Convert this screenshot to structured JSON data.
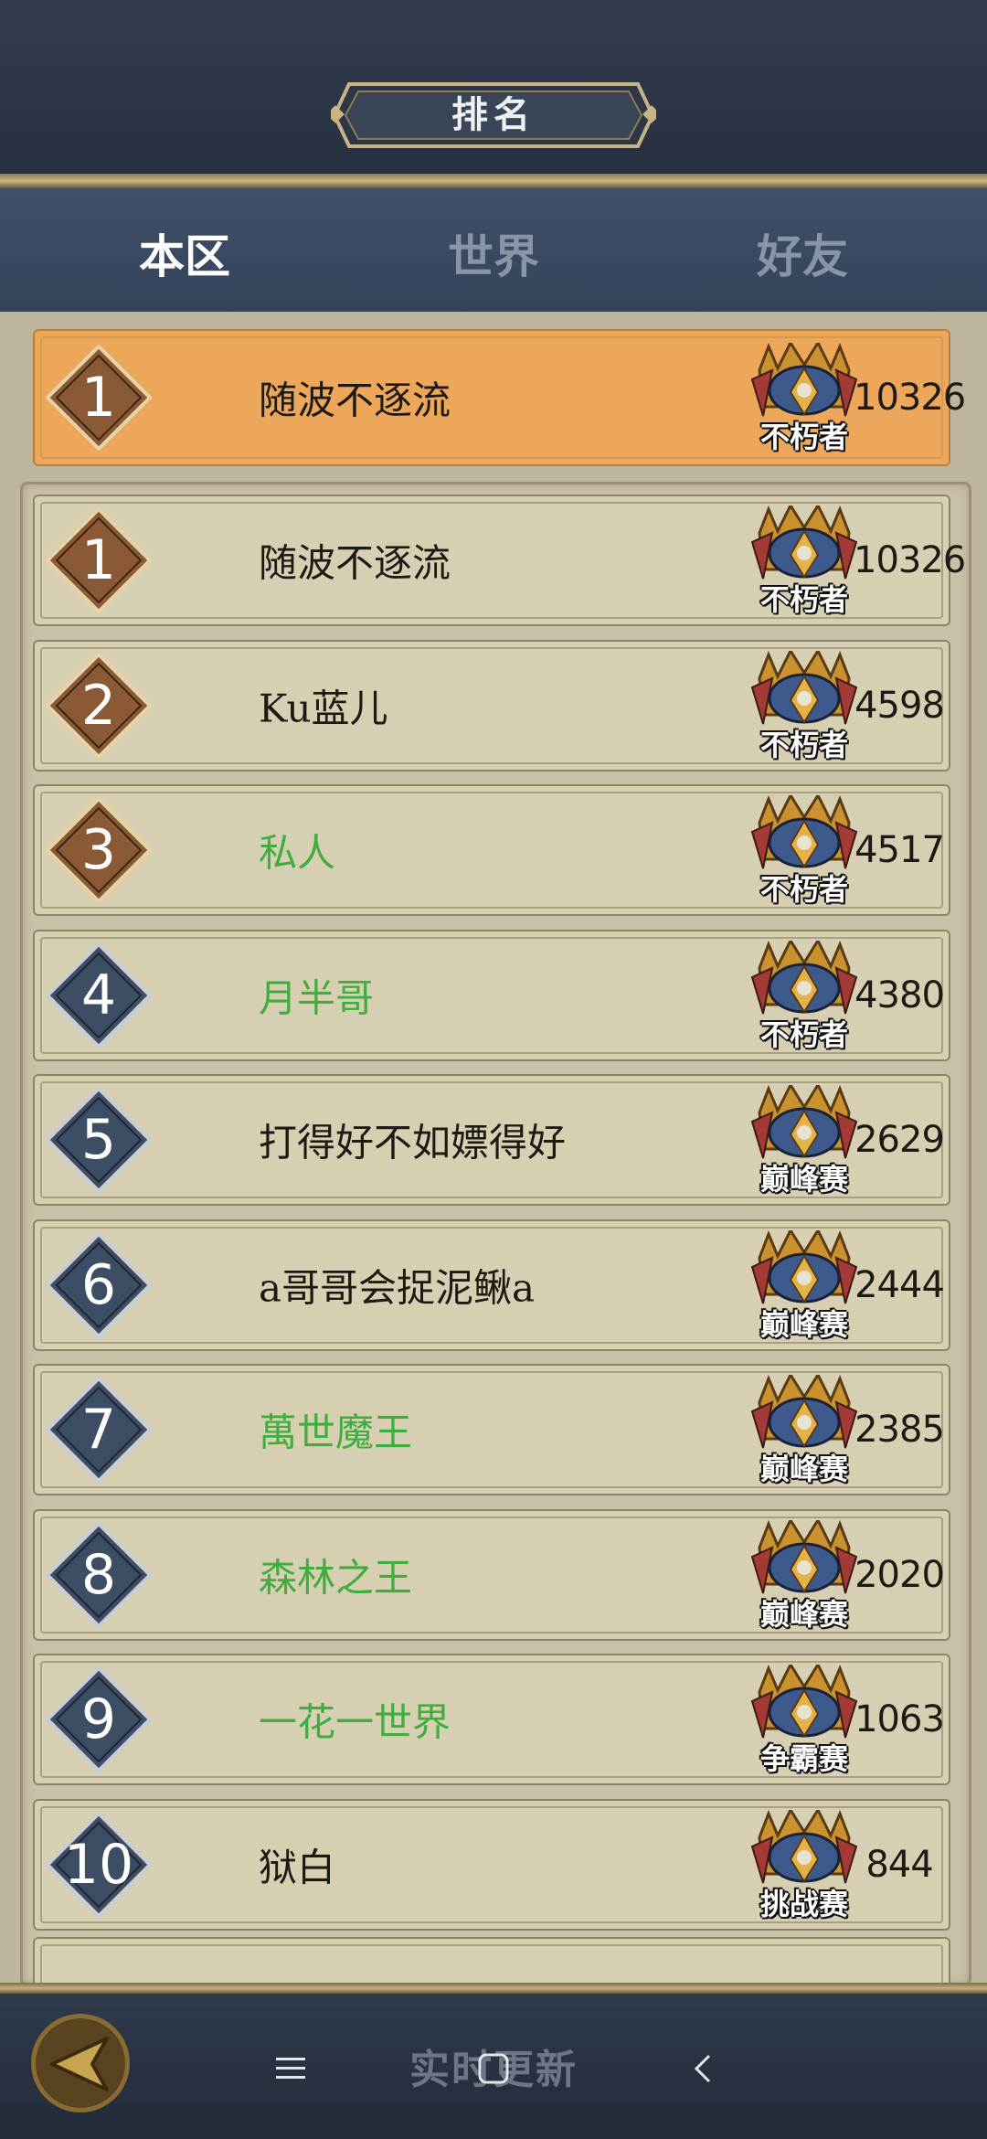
{
  "header": {
    "title": "排名"
  },
  "tabs": [
    {
      "label": "本区",
      "active": true
    },
    {
      "label": "世界",
      "active": false
    },
    {
      "label": "好友",
      "active": false
    }
  ],
  "my_rank": {
    "rank": "1",
    "name": "随波不逐流",
    "tier": "不朽者",
    "score": "10326",
    "name_color": "black"
  },
  "rankings": [
    {
      "rank": "1",
      "name": "随波不逐流",
      "tier": "不朽者",
      "score": "10326",
      "name_color": "black",
      "badge": "gold"
    },
    {
      "rank": "2",
      "name": "Ku蓝儿",
      "tier": "不朽者",
      "score": "4598",
      "name_color": "black",
      "badge": "gold"
    },
    {
      "rank": "3",
      "name": "私人",
      "tier": "不朽者",
      "score": "4517",
      "name_color": "green",
      "badge": "gold"
    },
    {
      "rank": "4",
      "name": "月半哥",
      "tier": "不朽者",
      "score": "4380",
      "name_color": "green",
      "badge": "blue"
    },
    {
      "rank": "5",
      "name": "打得好不如嫖得好",
      "tier": "巅峰赛",
      "score": "2629",
      "name_color": "black",
      "badge": "blue"
    },
    {
      "rank": "6",
      "name": "a哥哥会捉泥鳅a",
      "tier": "巅峰赛",
      "score": "2444",
      "name_color": "black",
      "badge": "blue"
    },
    {
      "rank": "7",
      "name": "萬世魔王",
      "tier": "巅峰赛",
      "score": "2385",
      "name_color": "green",
      "badge": "blue"
    },
    {
      "rank": "8",
      "name": "森林之王",
      "tier": "巅峰赛",
      "score": "2020",
      "name_color": "green",
      "badge": "blue"
    },
    {
      "rank": "9",
      "name": "一花一世界",
      "tier": "争霸赛",
      "score": "1063",
      "name_color": "green",
      "badge": "blue"
    },
    {
      "rank": "10",
      "name": "狱白",
      "tier": "挑战赛",
      "score": "844",
      "name_color": "black",
      "badge": "blue"
    }
  ],
  "footer": {
    "status_text": "实时更新"
  },
  "colors": {
    "gold_badge": "#8a5a36",
    "blue_badge": "#3d4d63",
    "highlight_row": "#eca75b",
    "green_name": "#3fae3f"
  },
  "icons": {
    "back": "back-arrow-icon",
    "nav_menu": "menu-icon",
    "nav_home": "home-square-icon",
    "nav_back": "chevron-left-icon"
  }
}
